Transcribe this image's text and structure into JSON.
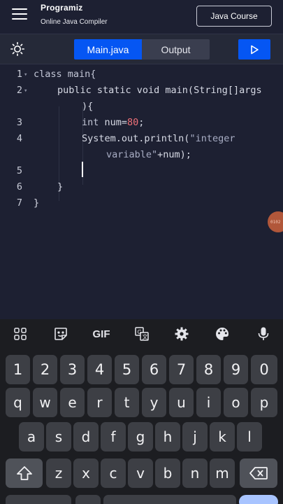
{
  "header": {
    "logo_text": "Programiz",
    "subtitle": "Online Java Compiler",
    "course_button": "Java Course"
  },
  "toolbar": {
    "tab_main": "Main.java",
    "tab_output": "Output",
    "theme_icon": "sun-icon",
    "run_icon": "play-icon"
  },
  "editor": {
    "line_numbers": [
      "1",
      "2",
      "3",
      "4",
      "5",
      "6",
      "7"
    ],
    "lines": {
      "l1": "class main{",
      "l2a": "public static void main(String[]args",
      "l2b": "){",
      "l3_kw": "int",
      "l3_rest": " num=",
      "l3_num": "80",
      "l3_end": ";",
      "l4_a": "System.out.println(",
      "l4_str1": "\"integer",
      "l4_str2": "variable\"",
      "l4_end": "+num);",
      "l6": "}",
      "l7": "}"
    },
    "floating_badge": "0102"
  },
  "keyboard": {
    "toolbar_icons": [
      "apps-grid-icon",
      "sticker-icon",
      "gif-icon",
      "translate-icon",
      "settings-gear-icon",
      "palette-icon",
      "microphone-icon"
    ],
    "gif_label": "GIF",
    "row_numbers": [
      "1",
      "2",
      "3",
      "4",
      "5",
      "6",
      "7",
      "8",
      "9",
      "0"
    ],
    "row_top": [
      "q",
      "w",
      "e",
      "r",
      "t",
      "y",
      "u",
      "i",
      "o",
      "p"
    ],
    "row_middle": [
      "a",
      "s",
      "d",
      "f",
      "g",
      "h",
      "j",
      "k",
      "l"
    ],
    "row_bottom": [
      "z",
      "x",
      "c",
      "v",
      "b",
      "n",
      "m"
    ],
    "shift_icon": "shift-icon",
    "backspace_icon": "backspace-icon"
  }
}
